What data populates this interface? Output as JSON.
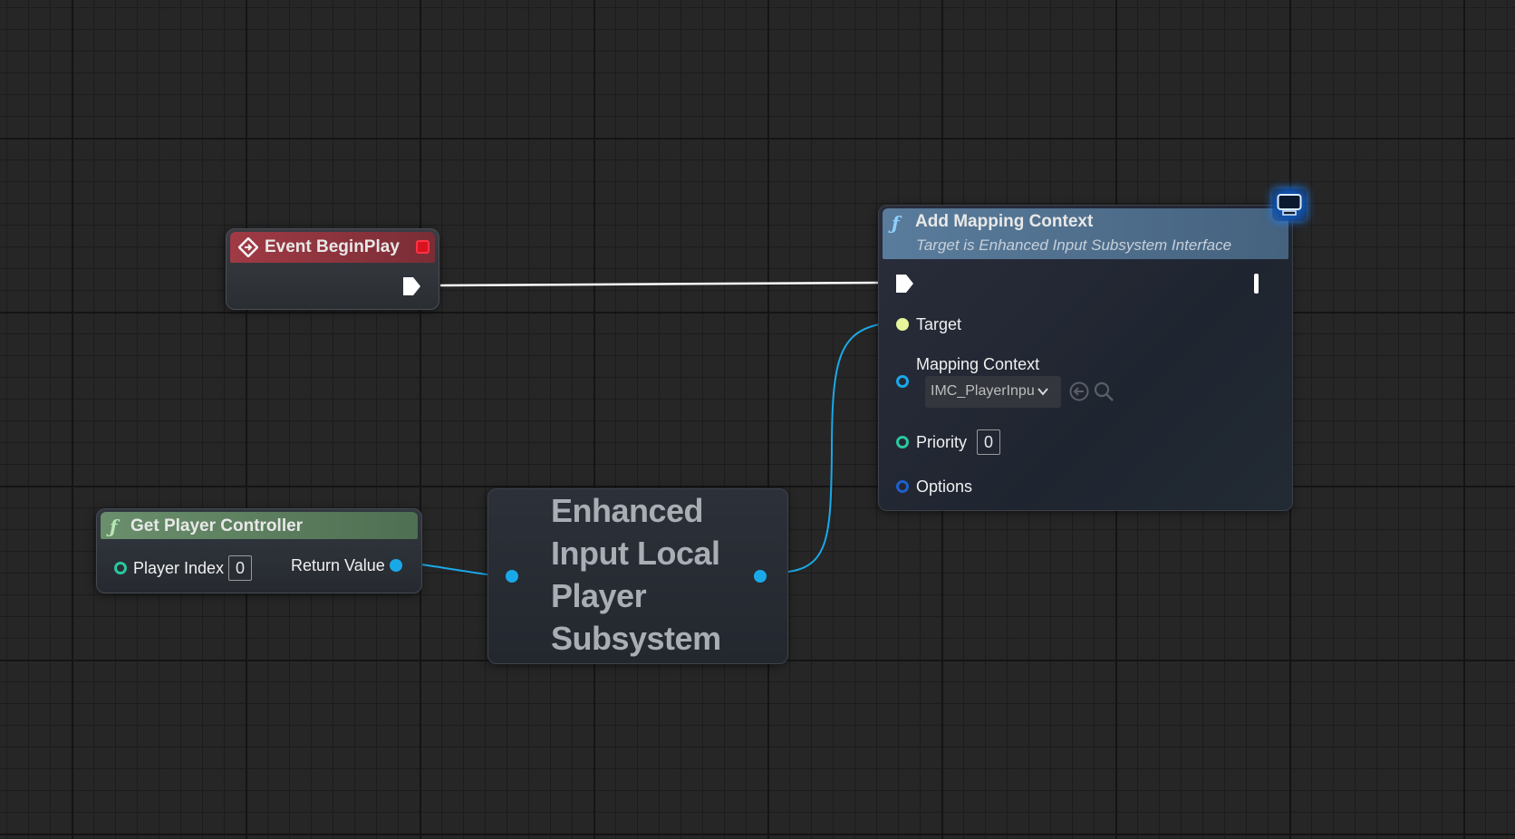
{
  "nodes": {
    "event_begin_play": {
      "title": "Event BeginPlay"
    },
    "get_player_controller": {
      "title": "Get Player Controller",
      "player_index_label": "Player Index",
      "player_index_value": "0",
      "return_value_label": "Return Value"
    },
    "subsystem": {
      "title": "Enhanced Input Local Player Subsystem"
    },
    "add_mapping_context": {
      "title": "Add Mapping Context",
      "subtitle": "Target is Enhanced Input Subsystem Interface",
      "target_label": "Target",
      "mapping_context_label": "Mapping Context",
      "mapping_context_value": "IMC_PlayerInpu",
      "priority_label": "Priority",
      "priority_value": "0",
      "options_label": "Options"
    }
  },
  "icons": {
    "function": "ƒ"
  },
  "colors": {
    "grid_background": "#262626",
    "event_header": "#a03a45",
    "pure_function_header": "#5a7a5c",
    "function_header": "#4e6c8a",
    "exec_wire": "#ffffff",
    "object_pin": "#1aa9e8",
    "integer_pin": "#2ac7a0",
    "target_pin": "#e6f59a",
    "options_pin": "#1f5fcc"
  }
}
